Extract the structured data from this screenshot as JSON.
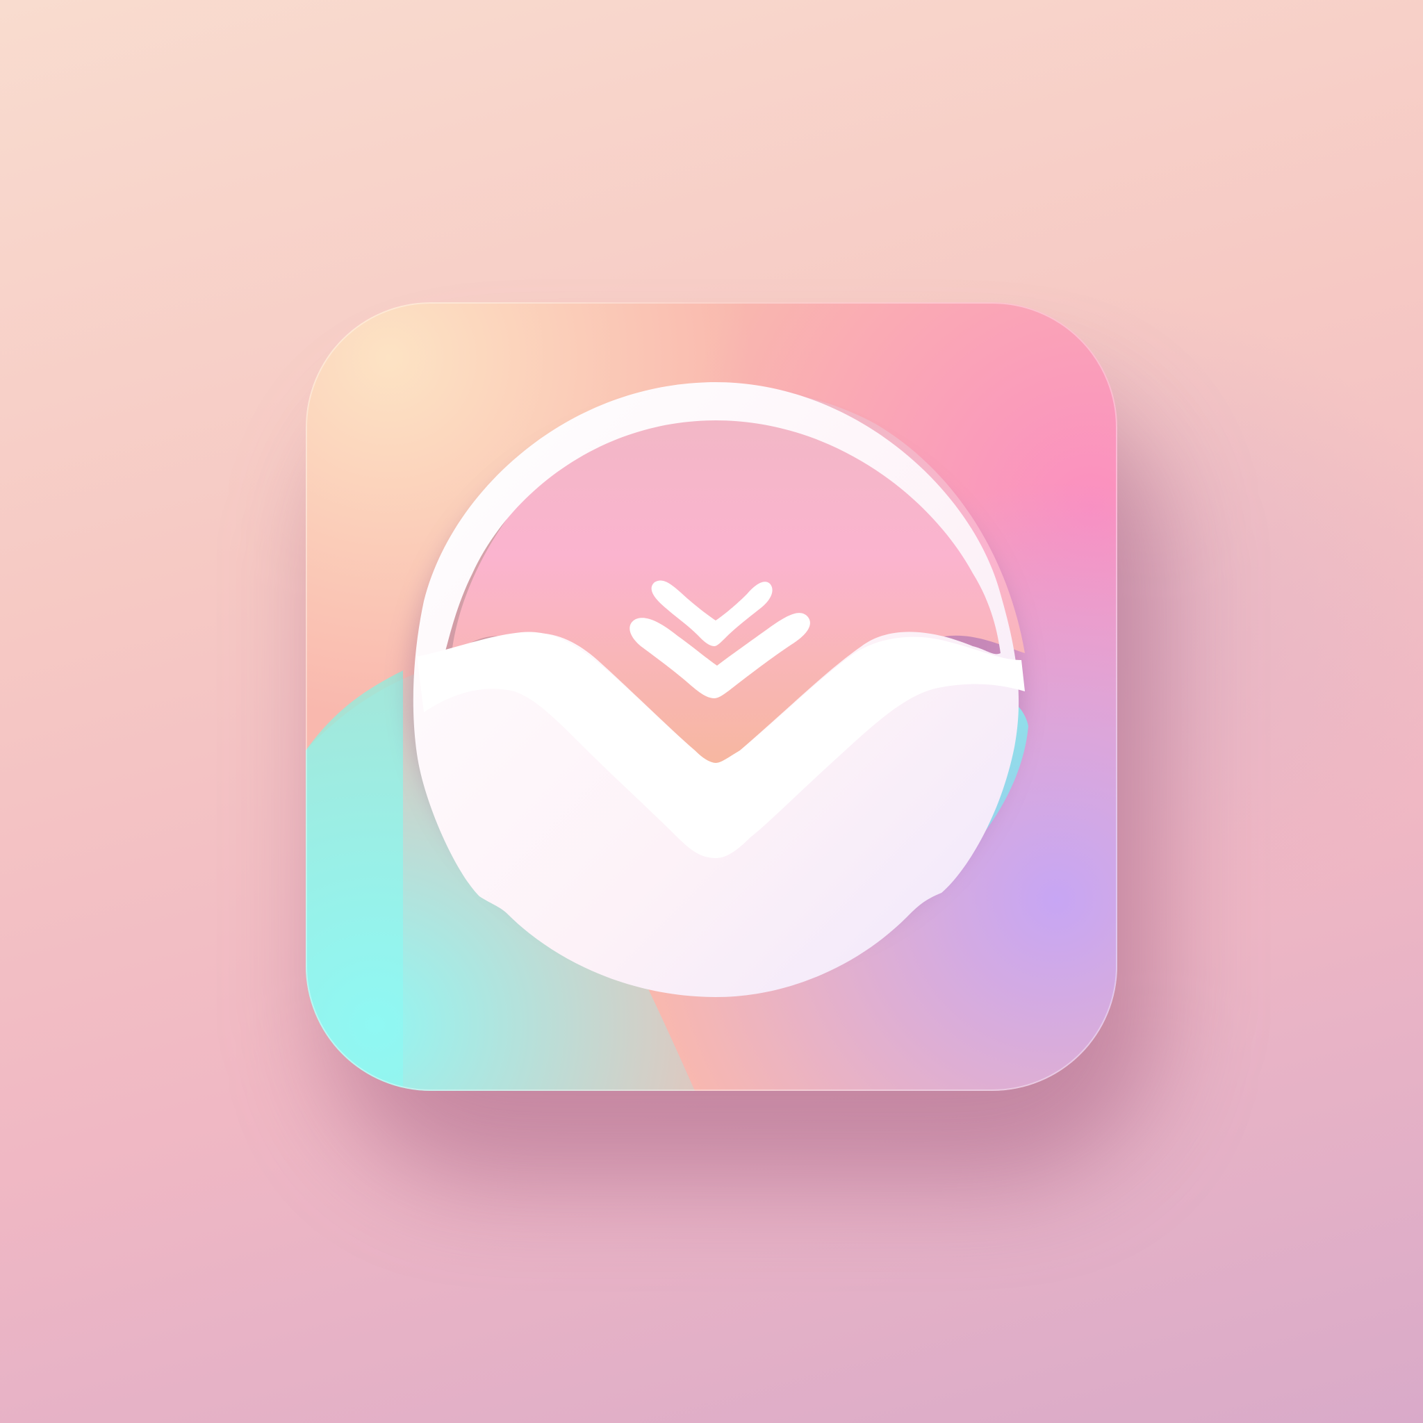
{
  "icon": {
    "name": "app-icon",
    "glyph": "heart-v-chevron-icon"
  },
  "colors": {
    "background_top": "#f9dccf",
    "background_bottom": "#d9aac9",
    "tile_peach": "#fcd9b8",
    "tile_pink": "#fb8fc0",
    "tile_mint": "#8ff8f4",
    "tile_lavender": "#c7aaf2",
    "ring": "#ffffff"
  }
}
